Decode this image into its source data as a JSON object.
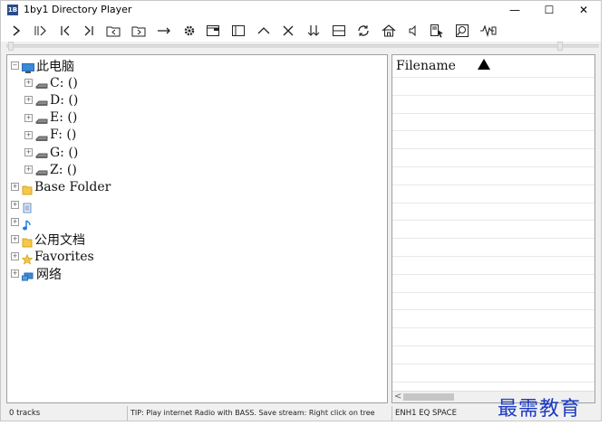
{
  "window": {
    "title": "1by1 Directory Player",
    "app_icon": "1B",
    "minimize_glyph": "—",
    "maximize_glyph": "☐",
    "close_glyph": "✕"
  },
  "toolbar": {
    "buttons": [
      {
        "icon": "play-icon"
      },
      {
        "icon": "play-pause-icon"
      },
      {
        "icon": "previous-icon"
      },
      {
        "icon": "next-icon"
      },
      {
        "icon": "folder-back-icon"
      },
      {
        "icon": "folder-forward-icon"
      },
      {
        "icon": "arrow-right-icon"
      },
      {
        "icon": "gear-icon"
      },
      {
        "icon": "window-icon"
      },
      {
        "icon": "panel-icon"
      },
      {
        "icon": "caret-up-icon"
      },
      {
        "icon": "close-icon"
      },
      {
        "icon": "sort-down-icon"
      },
      {
        "icon": "split-icon"
      },
      {
        "icon": "refresh-icon"
      },
      {
        "icon": "home-icon"
      },
      {
        "icon": "speaker-icon"
      },
      {
        "icon": "doc-pointer-icon"
      },
      {
        "icon": "search-icon"
      },
      {
        "icon": "wave-icon"
      }
    ]
  },
  "tree": {
    "items": [
      {
        "label": "此电脑",
        "icon": "computer-icon",
        "expander": "⊟",
        "level": 0
      },
      {
        "label": "C: ()",
        "icon": "drive-icon",
        "expander": "⊞",
        "level": 1
      },
      {
        "label": "D: ()",
        "icon": "drive-icon",
        "expander": "⊞",
        "level": 1
      },
      {
        "label": "E: ()",
        "icon": "drive-icon",
        "expander": "⊞",
        "level": 1
      },
      {
        "label": "F: ()",
        "icon": "drive-icon",
        "expander": "⊞",
        "level": 1
      },
      {
        "label": "G: ()",
        "icon": "drive-icon",
        "expander": "⊞",
        "level": 1
      },
      {
        "label": "Z: ()",
        "icon": "drive-icon",
        "expander": "⊞",
        "level": 1
      },
      {
        "label": "Base Folder",
        "icon": "folder-icon",
        "expander": "⊞",
        "level": 0
      },
      {
        "label": "",
        "icon": "document-icon",
        "expander": "⊞",
        "level": 0
      },
      {
        "label": "",
        "icon": "music-note-icon",
        "expander": "⊞",
        "level": 0
      },
      {
        "label": "公用文档",
        "icon": "folder-icon",
        "expander": "⊞",
        "level": 0
      },
      {
        "label": "Favorites",
        "icon": "star-icon",
        "expander": "⊞",
        "level": 0
      },
      {
        "label": "网络",
        "icon": "network-icon",
        "expander": "⊞",
        "level": 0
      }
    ]
  },
  "list": {
    "column_header": "Filename",
    "scroll_left_glyph": "<"
  },
  "status": {
    "tracks": "0 tracks",
    "tip": "TIP: Play internet Radio with BASS. Save stream: Right click on tree",
    "flags": "ENH1  EQ  SPACE"
  },
  "watermark": "最需教育",
  "colors": {
    "watermark": "#1a39c4",
    "folder": "#f5c84a",
    "computer": "#3a8ad6"
  }
}
